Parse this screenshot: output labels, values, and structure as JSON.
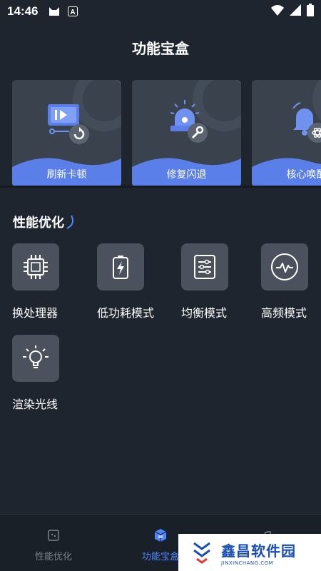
{
  "status_bar": {
    "time": "14:46",
    "icons": [
      "cat-icon",
      "a-notification-icon"
    ],
    "right_icons": [
      "wifi-icon",
      "signal-icon",
      "battery-icon"
    ]
  },
  "page": {
    "title": "功能宝盒"
  },
  "feature_cards": [
    {
      "label": "刷新卡顿",
      "icon": "refresh-screen-icon"
    },
    {
      "label": "修复闪退",
      "icon": "siren-wrench-icon"
    },
    {
      "label": "核心唤醒",
      "icon": "bell-atom-icon"
    }
  ],
  "section": {
    "title": "性能优化",
    "tools": [
      {
        "label": "换处理器",
        "icon": "chip-icon"
      },
      {
        "label": "低功耗模式",
        "icon": "battery-bolt-icon"
      },
      {
        "label": "均衡模式",
        "icon": "sliders-icon"
      },
      {
        "label": "高频模式",
        "icon": "pulse-circle-icon"
      },
      {
        "label": "渲染光线",
        "icon": "lightbulb-icon"
      }
    ]
  },
  "bottom_nav": {
    "items": [
      {
        "label": "性能优化",
        "icon": "performance-icon",
        "active": false
      },
      {
        "label": "功能宝盒",
        "icon": "box-icon",
        "active": true
      },
      {
        "label": "",
        "icon": "leaf-icon",
        "active": false
      }
    ]
  },
  "watermark": {
    "main": "鑫昌软件园",
    "sub": "JINXINCHANG.COM"
  },
  "colors": {
    "background": "#1e252e",
    "card": "#3a424e",
    "accent": "#4f86ff",
    "tile": "#4b525d"
  }
}
